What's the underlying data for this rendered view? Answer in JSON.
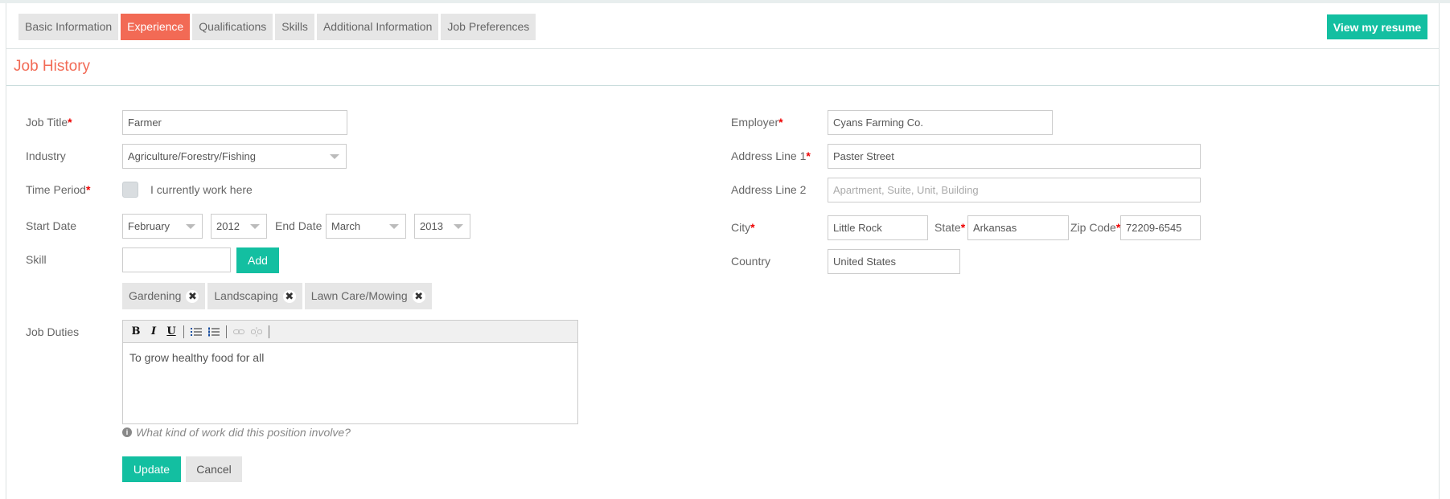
{
  "tabs": [
    "Basic Information",
    "Experience",
    "Qualifications",
    "Skills",
    "Additional Information",
    "Job Preferences"
  ],
  "active_tab": "Experience",
  "view_resume_label": "View my resume",
  "section_title": "Job History",
  "form": {
    "job_title_label": "Job Title",
    "job_title_value": "Farmer",
    "industry_label": "Industry",
    "industry_value": "Agriculture/Forestry/Fishing",
    "time_period_label": "Time Period",
    "currently_work_label": "I currently work here",
    "start_date_label": "Start Date",
    "start_month": "February",
    "start_year": "2012",
    "end_date_label": "End Date",
    "end_month": "March",
    "end_year": "2013",
    "skill_label": "Skill",
    "skill_input_value": "",
    "add_label": "Add",
    "skills": [
      "Gardening",
      "Landscaping",
      "Lawn Care/Mowing"
    ],
    "job_duties_label": "Job Duties",
    "job_duties_value": "To grow healthy food for all",
    "hint_text": "What kind of work did this position involve?",
    "update_label": "Update",
    "cancel_label": "Cancel",
    "employer_label": "Employer",
    "employer_value": "Cyans Farming Co.",
    "address1_label": "Address Line 1",
    "address1_value": "Paster Street",
    "address2_label": "Address Line 2",
    "address2_placeholder": "Apartment, Suite, Unit, Building",
    "city_label": "City",
    "city_value": "Little Rock",
    "state_label": "State",
    "state_value": "Arkansas",
    "zip_label": "Zip Code",
    "zip_value": "72209-6545",
    "country_label": "Country",
    "country_value": "United States",
    "required_marker": "*"
  },
  "editor_tools": {
    "bold": "B",
    "italic": "I",
    "underline": "U",
    "icons": [
      "bold-icon",
      "italic-icon",
      "underline-icon",
      "bulleted-list-icon",
      "numbered-list-icon",
      "link-icon",
      "unlink-icon"
    ]
  },
  "colors": {
    "accent_coral": "#f26a55",
    "accent_teal": "#13bfa1",
    "required_red": "#ee0000"
  }
}
